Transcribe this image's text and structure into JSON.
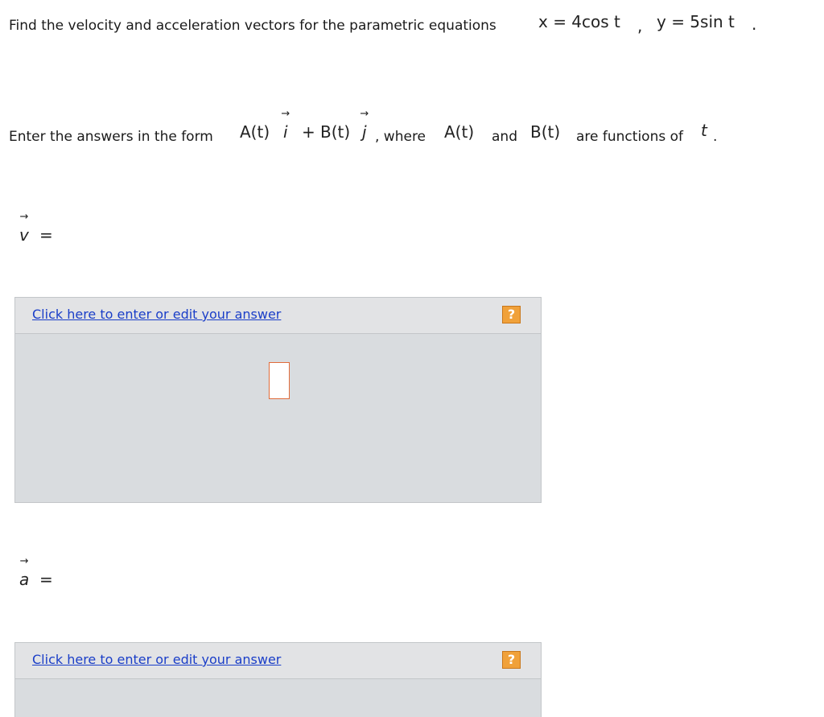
{
  "question": {
    "prompt": "Find the velocity and acceleration vectors for the parametric equations",
    "eq_x": "x = 4cos t",
    "sep": ",",
    "eq_y": "y = 5sin t",
    "end": "."
  },
  "instructions": {
    "prefix": "Enter the answers in the form",
    "form_a": "A(t)",
    "form_i": "i",
    "form_plus": "+",
    "form_b": "B(t)",
    "form_j": "j",
    "comma_where": ", where",
    "at": "A(t)",
    "and": "and",
    "bt": "B(t)",
    "are_functions": "are functions of",
    "t": "t",
    "period": "."
  },
  "arrow_glyph": "→",
  "velocity": {
    "symbol": "v",
    "equals": "=",
    "link": "Click here to enter or edit your answer",
    "help": "?"
  },
  "acceleration": {
    "symbol": "a",
    "equals": "=",
    "link": "Click here to enter or edit your answer",
    "help": "?"
  },
  "colors": {
    "link": "#1a3ec8",
    "help_button": "#f0a13a",
    "panel": "#d9dcdf",
    "panel_header": "#e2e3e5",
    "cursor_border": "#e06b3a"
  },
  "icons": {
    "help": "question-mark-icon"
  }
}
